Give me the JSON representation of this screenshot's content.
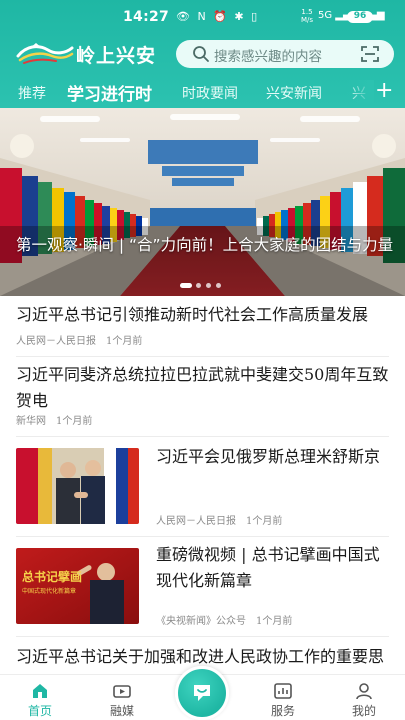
{
  "status_bar": {
    "time": "14:27",
    "icons": "👁 N ⏰ ✱ ▯",
    "net_speed": "1.5",
    "net_unit": "M/s",
    "signal": "5G ▂▄▆ ▂▄▆",
    "battery": "96"
  },
  "header": {
    "app_title": "岭上兴安",
    "search_placeholder": "搜索感兴趣的内容"
  },
  "tabs": [
    {
      "label": "推荐"
    },
    {
      "label": "学习进行时",
      "active": true
    },
    {
      "label": "时政要闻"
    },
    {
      "label": "兴安新闻"
    },
    {
      "label": "兴"
    }
  ],
  "tab_more_label": "+",
  "banner": {
    "caption": "第一观察·瞬间 | “合”力向前！上合大家庭的团结与力量",
    "active_dot": 1,
    "dot_count": 4
  },
  "news": [
    {
      "title": "习近平总书记引领推动新时代社会工作高质量发展",
      "source": "人民网－人民日报",
      "time": "1个月前"
    },
    {
      "title": "习近平同斐济总统拉拉巴拉武就中斐建交50周年互致贺电",
      "source": "新华网",
      "time": "1个月前"
    },
    {
      "title": "习近平会见俄罗斯总理米舒斯京",
      "source": "人民网－人民日报",
      "time": "1个月前",
      "thumbnail": "meeting-photo"
    },
    {
      "title": "重磅微视频 | 总书记擘画中国式现代化新篇章",
      "source": "《央视新闻》公众号",
      "time": "1个月前",
      "thumbnail": "video-cover",
      "thumbnail_text": "总书记擘画",
      "thumbnail_subtext": "中国式现代化新篇章"
    },
    {
      "title": "习近平总书记关于加强和改进人民政协工作的重要思想的原创性贡献",
      "source": "",
      "time": ""
    }
  ],
  "bottom_nav": [
    {
      "label": "首页",
      "icon": "home-icon",
      "active": true
    },
    {
      "label": "融媒",
      "icon": "media-icon"
    },
    {
      "label": "",
      "icon": "center-chat-icon"
    },
    {
      "label": "服务",
      "icon": "service-icon"
    },
    {
      "label": "我的",
      "icon": "profile-icon"
    }
  ],
  "colors": {
    "brand": "#1fb7a4",
    "header_light": "#2cc2b0",
    "banner_red_carpet": "#b0242a"
  }
}
